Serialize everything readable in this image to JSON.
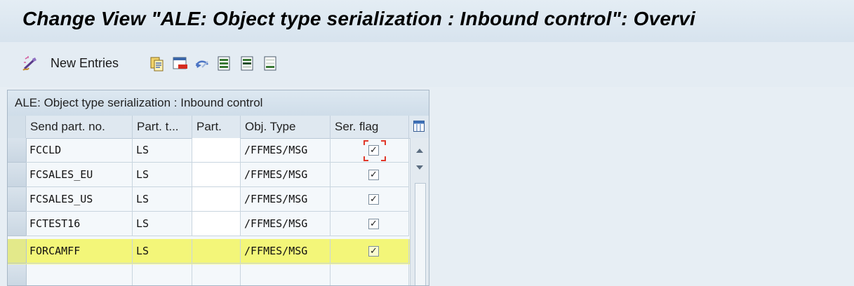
{
  "window": {
    "title": "Change View \"ALE: Object type serialization : Inbound control\": Overvi"
  },
  "toolbar": {
    "new_entries_label": "New Entries",
    "icons": [
      "display-change-icon",
      "copy-icon",
      "delete-icon",
      "undo-icon",
      "select-all-icon",
      "select-block-icon",
      "deselect-all-icon"
    ]
  },
  "table": {
    "title": "ALE: Object type serialization : Inbound control",
    "columns": [
      "Send part. no.",
      "Part. t...",
      "Part.",
      "Obj. Type",
      "Ser. flag"
    ],
    "rows": [
      {
        "send_part": "FCCLD",
        "part_type": "LS",
        "part": "",
        "obj_type": "/FFMES/MSG",
        "ser_flag": "✓"
      },
      {
        "send_part": "FCSALES_EU",
        "part_type": "LS",
        "part": "",
        "obj_type": "/FFMES/MSG",
        "ser_flag": "✓"
      },
      {
        "send_part": "FCSALES_US",
        "part_type": "LS",
        "part": "",
        "obj_type": "/FFMES/MSG",
        "ser_flag": "✓"
      },
      {
        "send_part": "FCTEST16",
        "part_type": "LS",
        "part": "",
        "obj_type": "/FFMES/MSG",
        "ser_flag": "✓"
      },
      {
        "send_part": "FORCAMFF",
        "part_type": "LS",
        "part": "",
        "obj_type": "/FFMES/MSG",
        "ser_flag": "✓"
      }
    ],
    "highlight_color": "#f3f56a"
  },
  "colors": {
    "title_bg": "#d7e3ee",
    "focus_marker": "#e0392b"
  }
}
